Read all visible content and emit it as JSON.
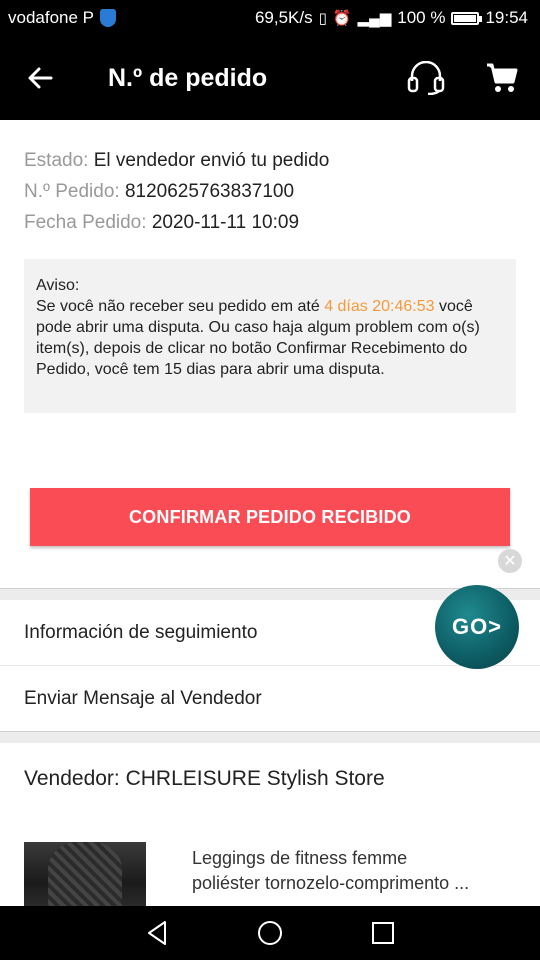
{
  "status_bar": {
    "carrier": "vodafone P",
    "speed": "69,5K/s",
    "battery": "100 %",
    "time": "19:54"
  },
  "appbar": {
    "title": "N.º de pedido",
    "icons": [
      "back-arrow-icon",
      "headset-icon",
      "cart-icon"
    ]
  },
  "order": {
    "status_label": "Estado:",
    "status_value": "El vendedor envió tu pedido",
    "number_label": "N.º Pedido:",
    "number_value": "8120625763837100",
    "date_label": "Fecha Pedido:",
    "date_value": "2020-11-11 10:09"
  },
  "notice": {
    "heading": "Aviso:",
    "line1_before": "Se você não receber seu pedido em até ",
    "countdown": "4 días 20:46:53",
    "rest": "você pode abrir uma disputa. Ou caso haja algum problem com o(s) item(s), depois de clicar no botão Confirmar Recebimento do Pedido, você tem 15 dias para abrir uma disputa.",
    "highlight_color": "#f39a3b"
  },
  "confirm_button": "CONFIRMAR PEDIDO RECIBIDO",
  "links": {
    "tracking": "Información de seguimiento",
    "message": "Enviar Mensaje al Vendedor"
  },
  "seller": {
    "label": "Vendedor: CHRLEISURE Stylish Store"
  },
  "product": {
    "title_line1": "Leggings de fitness femme",
    "title_line2": "poliéster tornozelo-comprimento ..."
  },
  "floating_button": "GO>",
  "colors": {
    "accent": "#fa4c55",
    "bar": "#000000"
  }
}
